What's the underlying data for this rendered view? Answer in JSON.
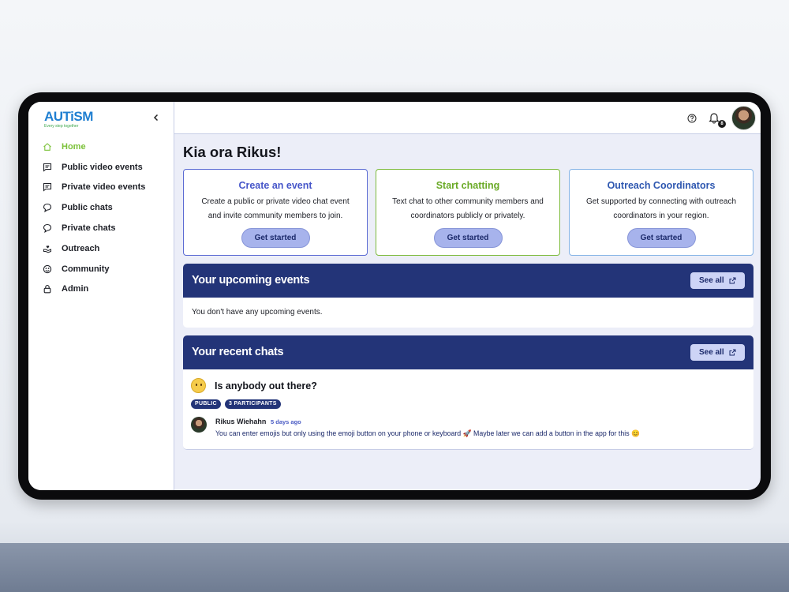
{
  "brand": {
    "logo_text": "AUTiSM",
    "logo_tagline": "Every step together"
  },
  "sidebar": {
    "items": [
      {
        "label": "Home",
        "icon": "home-icon",
        "active": true
      },
      {
        "label": "Public video events",
        "icon": "message-square-icon"
      },
      {
        "label": "Private video events",
        "icon": "message-square-icon"
      },
      {
        "label": "Public chats",
        "icon": "chat-bubble-icon"
      },
      {
        "label": "Private chats",
        "icon": "chat-bubble-icon"
      },
      {
        "label": "Outreach",
        "icon": "hand-heart-icon"
      },
      {
        "label": "Community",
        "icon": "community-icon"
      },
      {
        "label": "Admin",
        "icon": "lock-icon"
      }
    ]
  },
  "topbar": {
    "notification_count": "8"
  },
  "main": {
    "greeting": "Kia ora Rikus!",
    "cards": [
      {
        "title": "Create an event",
        "line1": "Create a public or private video chat event",
        "line2": "and invite community members to join.",
        "button": "Get started",
        "color": "#4656c9"
      },
      {
        "title": "Start chatting",
        "line1": "Text chat to other community members and",
        "line2": "coordinators publicly or privately.",
        "button": "Get started",
        "color": "#6aaa26"
      },
      {
        "title": "Outreach Coordinators",
        "line1": "Get supported by connecting with outreach",
        "line2": "coordinators in your region.",
        "button": "Get started",
        "color": "#2e57b0"
      }
    ],
    "upcoming": {
      "title": "Your upcoming events",
      "see_all": "See all",
      "empty": "You don't have any upcoming events."
    },
    "recent_chats": {
      "title": "Your recent chats",
      "see_all": "See all",
      "chat": {
        "title": "Is anybody out there?",
        "tags": [
          "PUBLIC",
          "3 PARTICIPANTS"
        ],
        "author": "Rikus Wiehahn",
        "time": "5 days ago",
        "message": "You can enter emojis but only using the emoji button on your phone or keyboard 🚀 Maybe later we can add a button in the app for this 😊"
      }
    }
  },
  "colors": {
    "accent_green": "#7cc23a",
    "panel_header": "#233478",
    "button_bg": "#a7b3ec"
  }
}
